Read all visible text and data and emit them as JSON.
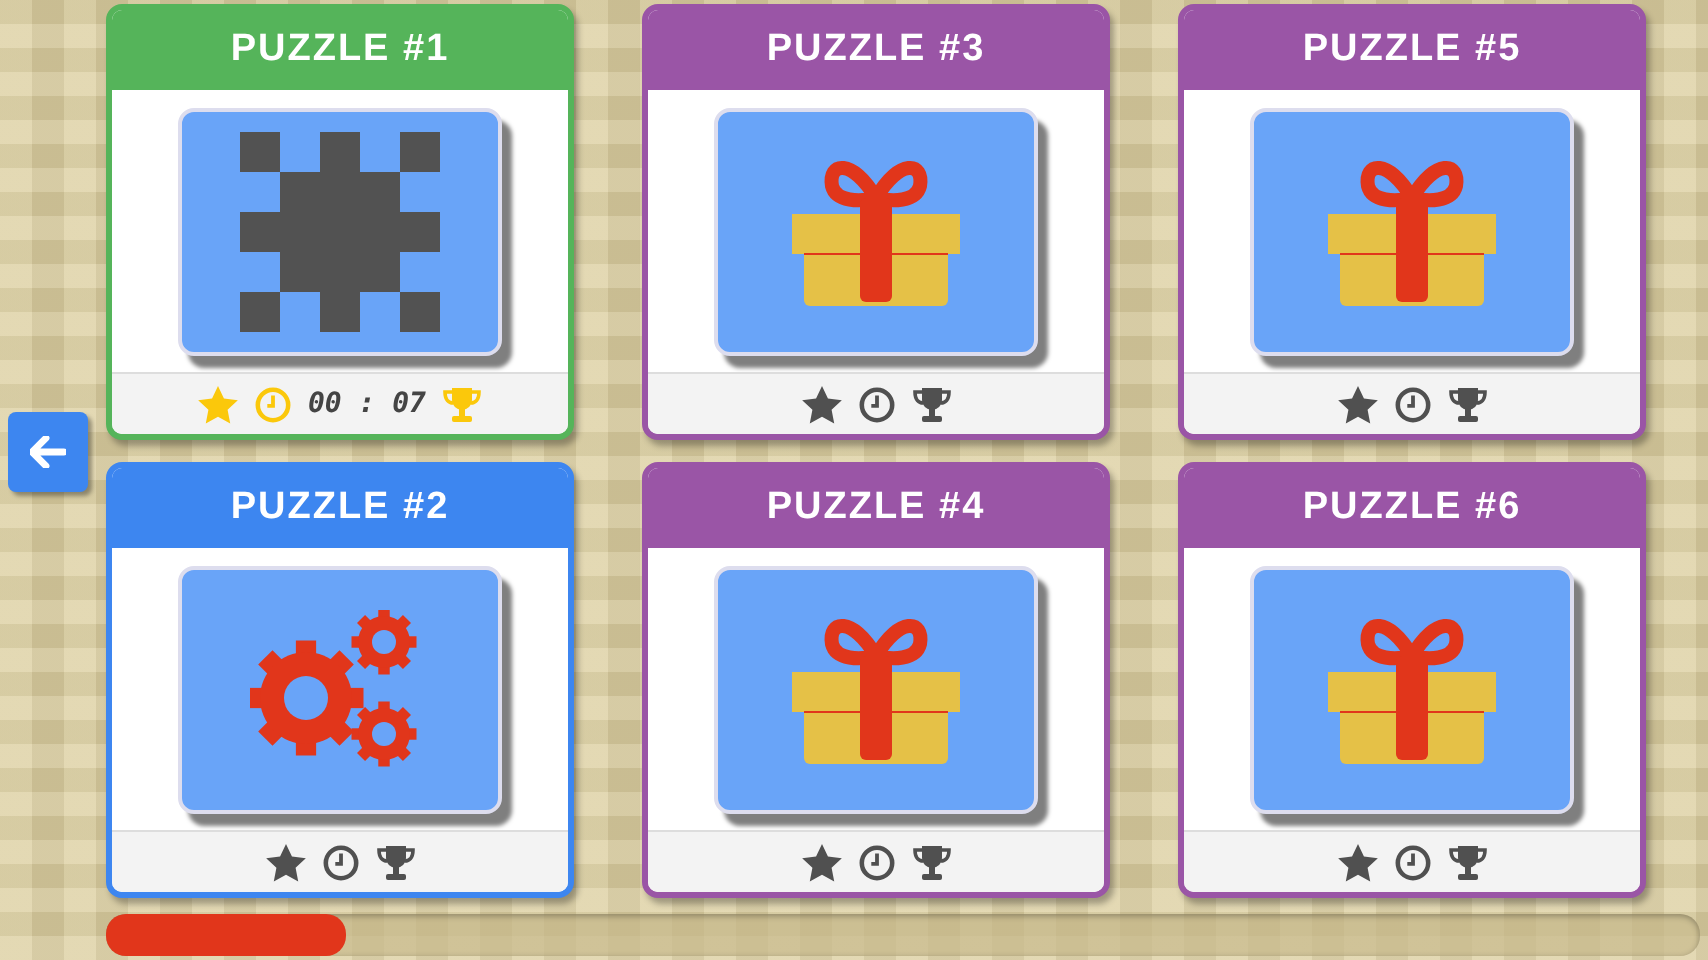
{
  "puzzles": [
    {
      "title": "PUZZLE #1",
      "color": "#55b45a",
      "kind": "pattern",
      "completed": true,
      "time": "00 : 07"
    },
    {
      "title": "PUZZLE #2",
      "color": "#3d86f0",
      "kind": "gears",
      "completed": false
    },
    {
      "title": "PUZZLE #3",
      "color": "#9a55a6",
      "kind": "gift",
      "completed": false
    },
    {
      "title": "PUZZLE #4",
      "color": "#9a55a6",
      "kind": "gift",
      "completed": false
    },
    {
      "title": "PUZZLE #5",
      "color": "#9a55a6",
      "kind": "gift",
      "completed": false
    },
    {
      "title": "PUZZLE #6",
      "color": "#9a55a6",
      "kind": "gift",
      "completed": false
    }
  ],
  "progress": {
    "level": 0.15
  }
}
